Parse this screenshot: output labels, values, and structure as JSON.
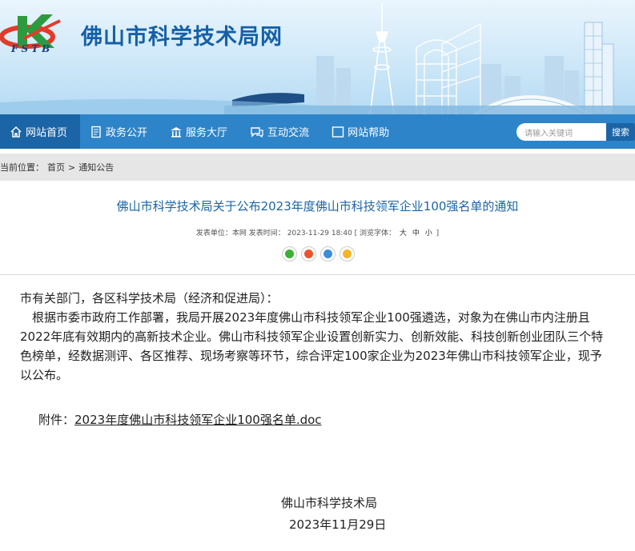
{
  "header": {
    "site_title": "佛山市科学技术局网",
    "logo_text": "FSTB",
    "colors": {
      "banner_sky": "#d3eaf9",
      "title": "#1460a8",
      "logo_red": "#e23b2a",
      "logo_green": "#2e9a3e"
    }
  },
  "nav": {
    "items": [
      {
        "label": "网站首页",
        "icon": "home-icon",
        "active": true
      },
      {
        "label": "政务公开",
        "icon": "document-icon",
        "active": false
      },
      {
        "label": "服务大厅",
        "icon": "building-icon",
        "active": false
      },
      {
        "label": "互动交流",
        "icon": "chat-icon",
        "active": false
      },
      {
        "label": "网站帮助",
        "icon": "help-icon",
        "active": false
      }
    ],
    "search_placeholder": "请输入关键词",
    "search_button": "搜索",
    "colors": {
      "bar": "#2e84c8",
      "active": "#1b64a6"
    }
  },
  "breadcrumb": {
    "prefix": "当前位置：",
    "home": "首页",
    "separator": ">",
    "current": "通知公告"
  },
  "article": {
    "title": "佛山市科学技术局关于公布2023年度佛山市科技领军企业100强名单的通知",
    "meta": {
      "publisher_label": "发表单位：",
      "publisher": "本网",
      "time_label": "发表时间：",
      "time": "2023-11-29 18:40",
      "font_label": "[ 浏览字体：",
      "font_large": "大",
      "font_medium": "中",
      "font_small": "小",
      "font_close": "]"
    },
    "share_icons": [
      "wechat-icon",
      "weibo-icon",
      "qq-icon",
      "favorite-icon"
    ],
    "salutation": "市有关部门，各区科学技术局（经济和促进局）：",
    "paragraph": "根据市委市政府工作部署，我局开展2023年度佛山市科技领军企业100强遴选，对象为在佛山市内注册且2022年底有效期内的高新技术企业。佛山市科技领军企业设置创新实力、创新效能、科技创新创业团队三个特色榜单，经数据测评、各区推荐、现场考察等环节，综合评定100家企业为2023年佛山市科技领军企业，现予以公布。",
    "attachment_label": "附件：",
    "attachment_link": "2023年度佛山市科技领军企业100强名单.doc",
    "signature": "佛山市科学技术局",
    "date": "2023年11月29日"
  }
}
